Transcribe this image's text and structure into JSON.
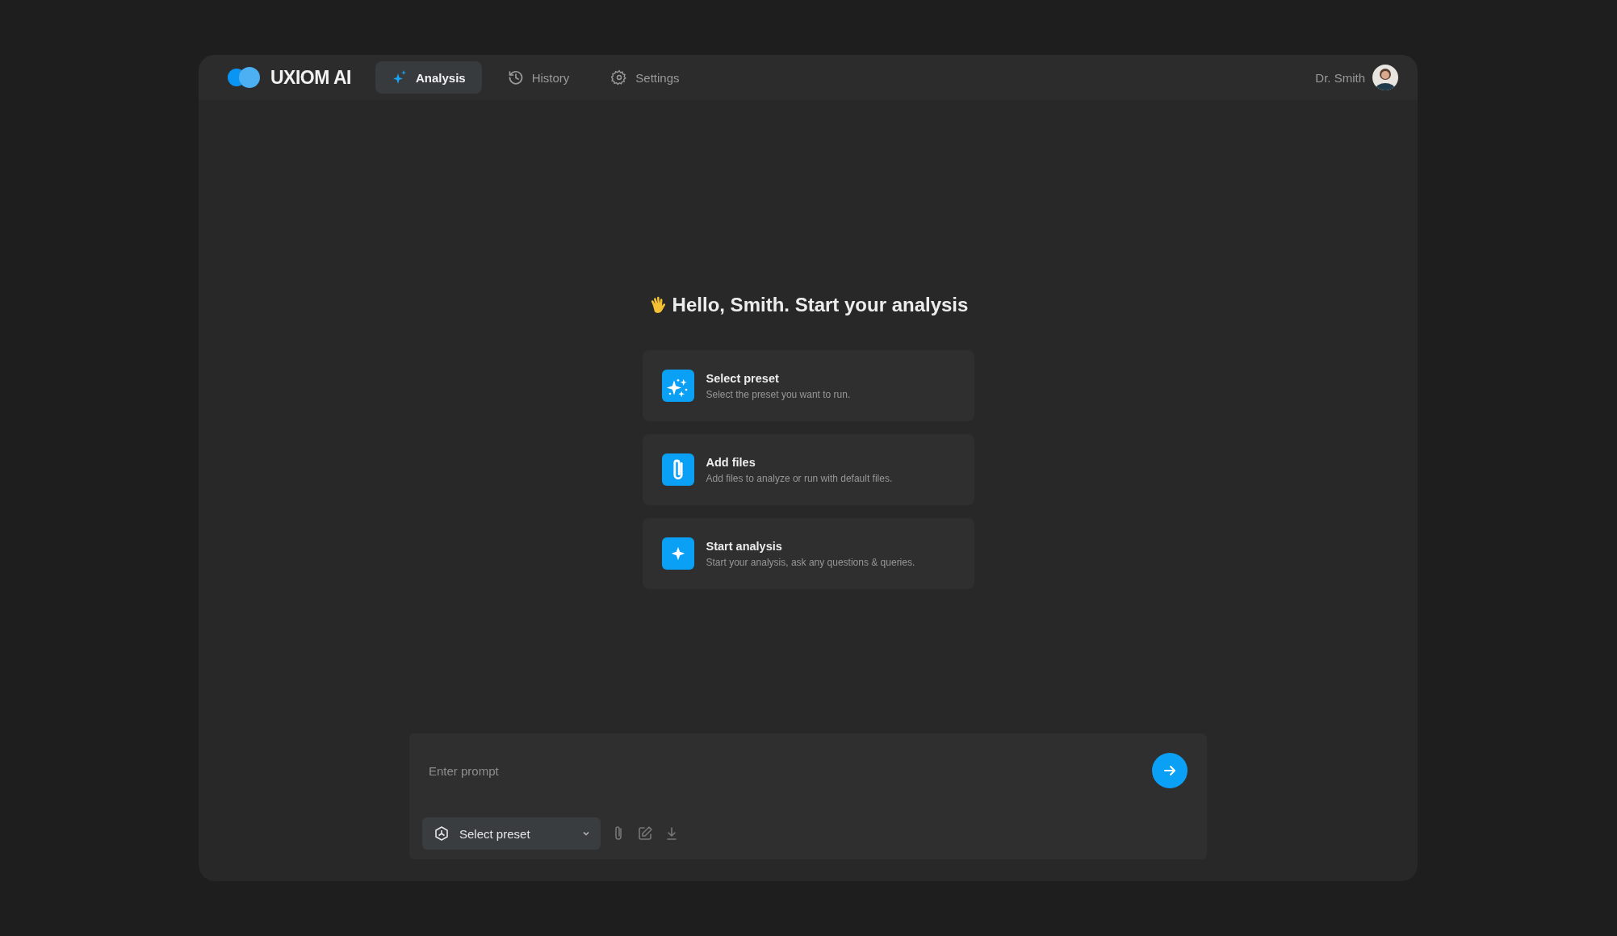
{
  "brand": {
    "name": "UXIOM AI"
  },
  "tabs": [
    {
      "label": "Analysis",
      "selected": true
    },
    {
      "label": "History",
      "selected": false
    },
    {
      "label": "Settings",
      "selected": false
    }
  ],
  "user": {
    "name": "Dr. Smith"
  },
  "greeting": "Hello, Smith. Start your analysis",
  "cards": [
    {
      "title": "Select preset",
      "description": "Select the preset you want to run."
    },
    {
      "title": "Add files",
      "description": "Add files to analyze or run with default files."
    },
    {
      "title": "Start analysis",
      "description": "Start your analysis, ask any questions & queries."
    }
  ],
  "prompt": {
    "placeholder": "Enter prompt"
  },
  "preset_select": {
    "value": "Select preset"
  }
}
